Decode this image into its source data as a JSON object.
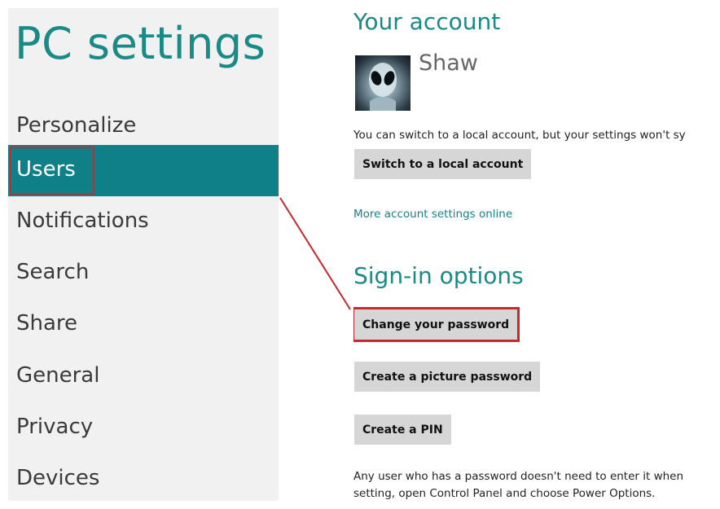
{
  "sidebar": {
    "title": "PC settings",
    "items": [
      {
        "label": "Personalize"
      },
      {
        "label": "Users",
        "selected": true
      },
      {
        "label": "Notifications"
      },
      {
        "label": "Search"
      },
      {
        "label": "Share"
      },
      {
        "label": "General"
      },
      {
        "label": "Privacy"
      },
      {
        "label": "Devices"
      }
    ]
  },
  "account": {
    "heading": "Your account",
    "username": "Shaw",
    "switch_note": "You can switch to a local account, but your settings won't sy",
    "switch_button": "Switch to a local account",
    "more_settings_link": "More account settings online"
  },
  "signin": {
    "heading": "Sign-in options",
    "change_password_button": "Change your password",
    "picture_password_button": "Create a picture password",
    "pin_button": "Create a PIN",
    "note_line1": "Any user who has a password doesn't need to enter it when",
    "note_line2": "setting, open Control Panel and choose Power Options."
  },
  "colors": {
    "accent": "#1a8a86",
    "selected_bg": "#0f8088",
    "highlight": "#c42a2f"
  }
}
